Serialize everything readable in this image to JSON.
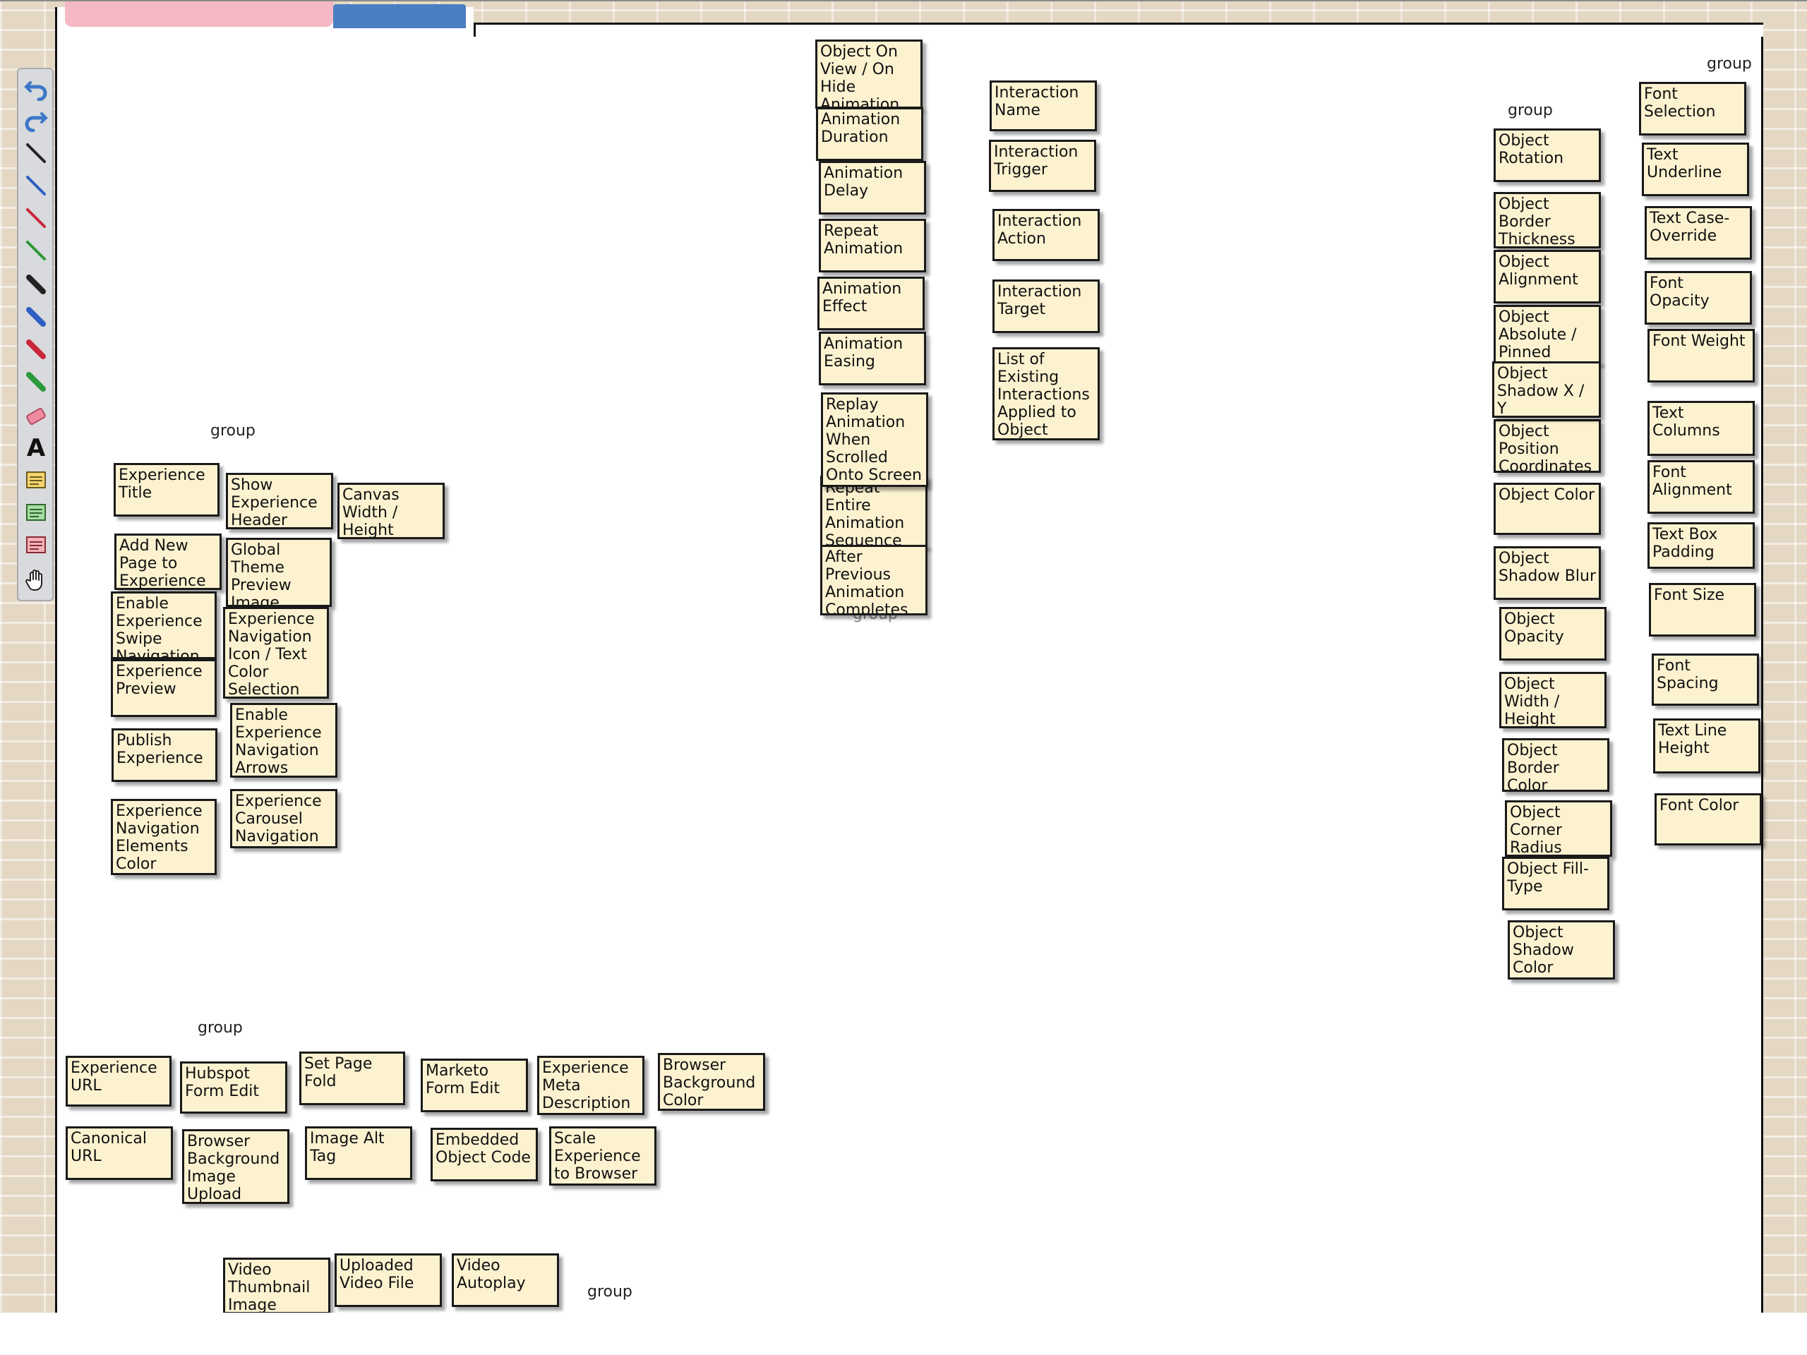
{
  "toolbar": {
    "tools": [
      "undo-icon",
      "redo-icon",
      "black-pen-icon",
      "blue-pen-icon",
      "red-pen-icon",
      "green-pen-icon",
      "black-marker-icon",
      "blue-marker-icon",
      "red-marker-icon",
      "green-marker-icon",
      "eraser-icon",
      "text-tool-icon",
      "yellow-note-icon",
      "green-note-icon",
      "red-note-icon",
      "hand-pan-icon"
    ],
    "text_tool_glyph": "A"
  },
  "groups": {
    "g1": "group",
    "g2": "group",
    "g3": "group",
    "g4": "group",
    "g5": "group",
    "g6": "group"
  },
  "notes": {
    "experience_title": "Experience Title",
    "show_experience_header": "Show Experience Header",
    "canvas_width_height": "Canvas Width / Height",
    "add_new_page": "Add New Page to Experience",
    "global_theme_preview": "Global Theme Preview Image",
    "enable_swipe_navigation": "Enable Experience Swipe Navigation",
    "nav_icon_text_color": "Experience Navigation Icon / Text Color Selection",
    "experience_preview": "Experience Preview",
    "publish_experience": "Publish Experience",
    "enable_nav_arrows": "Enable Experience Navigation Arrows",
    "nav_elements_color": "Experience Navigation Elements Color",
    "carousel_navigation": "Experience Carousel Navigation",
    "object_on_view_hide": "Object On View / On Hide Animation",
    "animation_duration": "Animation Duration",
    "animation_delay": "Animation Delay",
    "repeat_animation": "Repeat Animation",
    "animation_effect": "Animation Effect",
    "animation_easing": "Animation Easing",
    "replay_animation": "Replay Animation When Scrolled Onto Screen",
    "repeat_entire_sequence": "Repeat Entire Animation Sequence",
    "after_previous": "After Previous Animation Completes",
    "interaction_name": "Interaction Name",
    "interaction_trigger": "Interaction Trigger",
    "interaction_action": "Interaction Action",
    "interaction_target": "Interaction Target",
    "list_interactions": "List of Existing Interactions Applied to Object",
    "object_rotation": "Object Rotation",
    "object_border_thickness": "Object Border Thickness",
    "object_alignment": "Object Alignment",
    "object_absolute_pinned": "Object Absolute / Pinned",
    "object_shadow_xy": "Object Shadow X / Y",
    "object_position_coords": "Object Position Coordinates",
    "object_color": "Object Color",
    "object_shadow_blur": "Object Shadow Blur",
    "object_opacity": "Object Opacity",
    "object_width_height": "Object Width / Height",
    "object_border_color": "Object Border Color",
    "object_corner_radius": "Object Corner Radius",
    "object_fill_type": "Object Fill-Type",
    "object_shadow_color": "Object Shadow Color",
    "font_selection": "Font Selection",
    "text_underline": "Text Underline",
    "text_case_override": "Text Case-Override",
    "font_opacity": "Font Opacity",
    "font_weight": "Font Weight",
    "text_columns": "Text Columns",
    "font_alignment": "Font Alignment",
    "text_box_padding": "Text Box Padding",
    "font_size": "Font Size",
    "font_spacing": "Font Spacing",
    "text_line_height": "Text Line Height",
    "font_color": "Font Color",
    "experience_url": "Experience URL",
    "hubspot_form_edit": "Hubspot Form Edit",
    "set_page_fold": "Set Page Fold",
    "marketo_form_edit": "Marketo Form Edit",
    "experience_meta_description": "Experience Meta Description",
    "browser_background_color": "Browser Background Color",
    "canonical_url": "Canonical URL",
    "browser_bg_image_upload": "Browser Background Image Upload",
    "image_alt_tag": "Image Alt Tag",
    "embedded_object_code": "Embedded Object Code",
    "scale_experience": "Scale Experience to Browser",
    "video_thumbnail": "Video Thumbnail Image",
    "uploaded_video_file": "Uploaded Video File",
    "video_autoplay": "Video Autoplay"
  }
}
